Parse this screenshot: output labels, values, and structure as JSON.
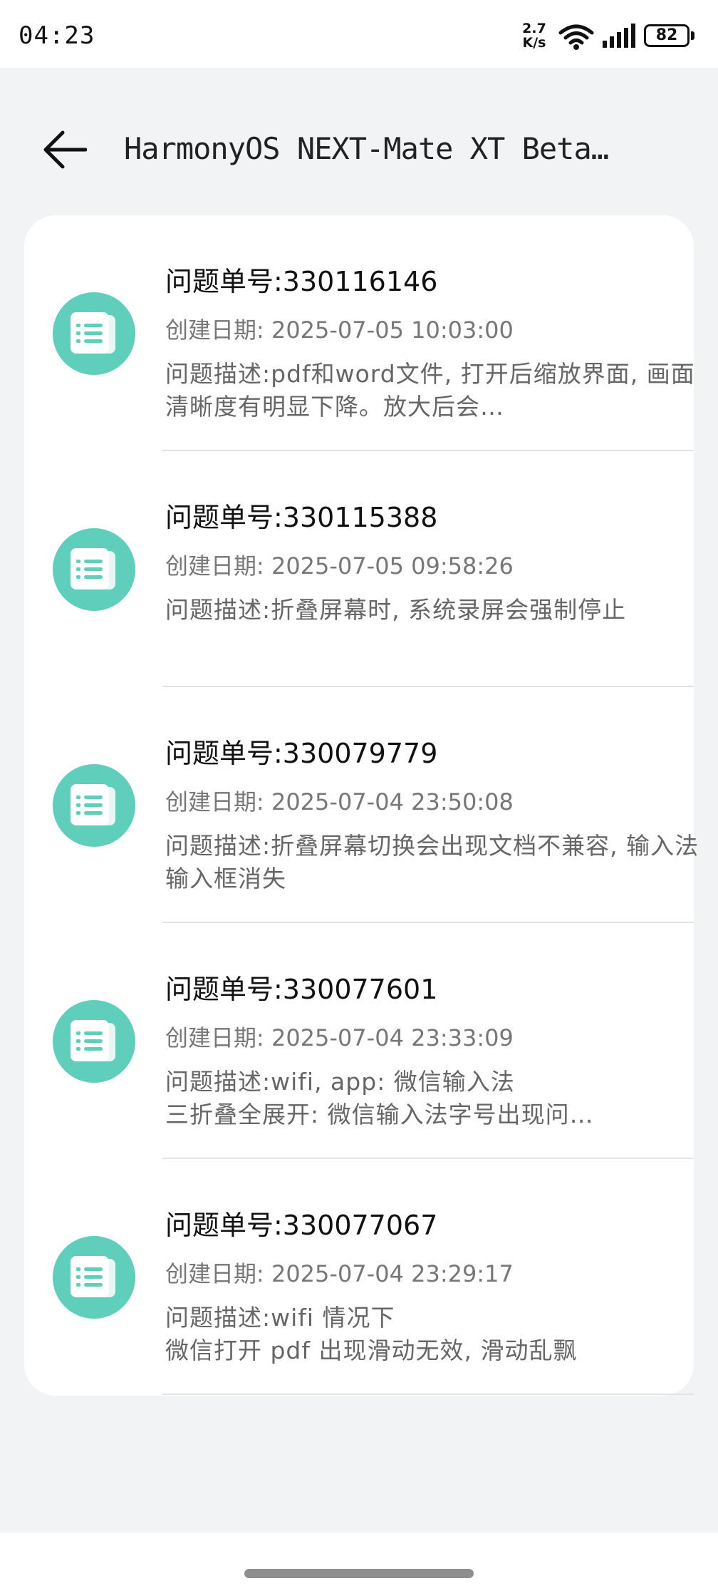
{
  "status_bar": {
    "time": "04:23",
    "net_speed_value": "2.7",
    "net_speed_unit": "K/s",
    "battery": "82",
    "icons": [
      "wifi-icon",
      "signal-icon",
      "battery-icon"
    ]
  },
  "header": {
    "back_icon": "arrow-left-icon",
    "title": "HarmonyOS NEXT-Mate XT Beta…"
  },
  "issues": [
    {
      "number": "问题单号:330116146",
      "date": "创建日期: 2025-07-05 10:03:00",
      "description": "问题描述:pdf和word文件, 打开后缩放界面, 画面清晰度有明显下降。放大后会…"
    },
    {
      "number": "问题单号:330115388",
      "date": "创建日期: 2025-07-05 09:58:26",
      "description": "问题描述:折叠屏幕时, 系统录屏会强制停止"
    },
    {
      "number": "问题单号:330079779",
      "date": "创建日期: 2025-07-04 23:50:08",
      "description": "问题描述:折叠屏幕切换会出现文档不兼容, 输入法输入框消失"
    },
    {
      "number": "问题单号:330077601",
      "date": "创建日期: 2025-07-04 23:33:09",
      "description": "问题描述:wifi, app: 微信输入法\n三折叠全展开: 微信输入法字号出现问…"
    },
    {
      "number": "问题单号:330077067",
      "date": "创建日期: 2025-07-04 23:29:17",
      "description": "问题描述:wifi 情况下\n微信打开 pdf 出现滑动无效, 滑动乱飘"
    }
  ],
  "item_icon": "document-list-icon",
  "colors": {
    "icon_bg": "#5fcfbb",
    "page_bg": "#f1f3f5",
    "card_bg": "#ffffff"
  }
}
